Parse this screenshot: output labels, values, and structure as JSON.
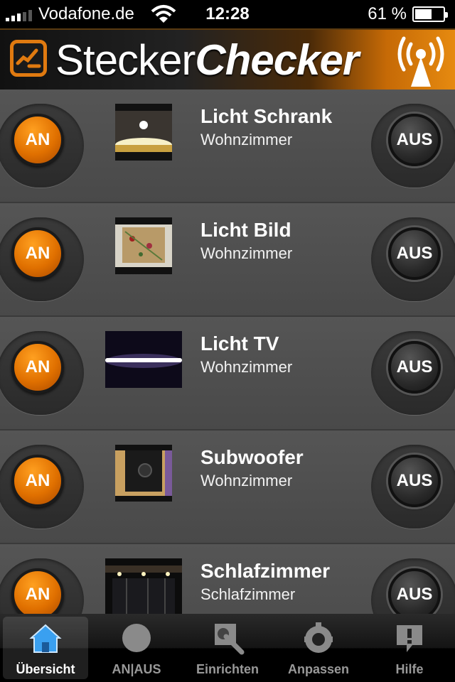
{
  "status_bar": {
    "carrier": "Vodafone.de",
    "time": "12:28",
    "battery_percent_label": "61 %",
    "battery_level": 0.61
  },
  "header": {
    "brand_part1": "Stecker",
    "brand_part2": "Checker"
  },
  "items": [
    {
      "title": "Licht Schrank",
      "room": "Wohnzimmer",
      "on_label": "AN",
      "off_label": "AUS"
    },
    {
      "title": "Licht Bild",
      "room": "Wohnzimmer",
      "on_label": "AN",
      "off_label": "AUS"
    },
    {
      "title": "Licht TV",
      "room": "Wohnzimmer",
      "on_label": "AN",
      "off_label": "AUS"
    },
    {
      "title": "Subwoofer",
      "room": "Wohnzimmer",
      "on_label": "AN",
      "off_label": "AUS"
    },
    {
      "title": "Schlafzimmer",
      "room": "Schlafzimmer",
      "on_label": "AN",
      "off_label": "AUS"
    }
  ],
  "tabs": [
    {
      "label": "Übersicht",
      "icon": "home-icon",
      "active": true
    },
    {
      "label": "AN|AUS",
      "icon": "circle-icon",
      "active": false
    },
    {
      "label": "Einrichten",
      "icon": "wrench-icon",
      "active": false
    },
    {
      "label": "Anpassen",
      "icon": "gear-icon",
      "active": false
    },
    {
      "label": "Hilfe",
      "icon": "help-bubble-icon",
      "active": false
    }
  ],
  "colors": {
    "accent_orange": "#e07000",
    "list_background": "#4b4b4b",
    "tab_active_icon": "#3aa0f0"
  }
}
